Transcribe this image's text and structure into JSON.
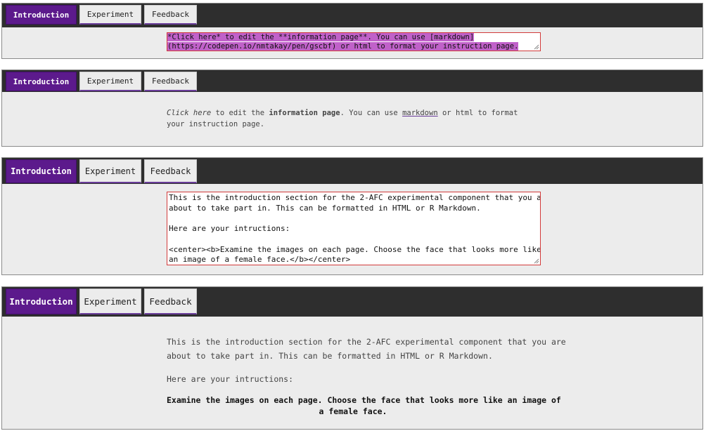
{
  "tabs": {
    "intro": "Introduction",
    "experiment": "Experiment",
    "feedback": "Feedback"
  },
  "colors": {
    "active_tab": "#5c1a8c",
    "tab_bar": "#2e2e2e",
    "panel": "#ececec",
    "highlight": "#c061c9",
    "editor_border": "#d23a3a"
  },
  "panel1": {
    "line1": "*Click here* to edit the **information page**. You can use [markdown]",
    "line2": "(https://codepen.io/nmtakay/pen/gscbf) or html to format your instruction page."
  },
  "panel2": {
    "click_here": "Click here",
    "to_edit": " to edit the ",
    "info_page": "information page",
    "you_can_use": ". You can use ",
    "markdown": "markdown",
    "or_html": " or html to format",
    "line2": "your instruction page."
  },
  "panel3": {
    "line1": "This is the introduction section for the 2-AFC experimental component that you are",
    "line2": "about to take part in. This can be formatted in HTML or R Markdown.",
    "line3": "Here are your intructions:",
    "line4": "<center><b>Examine the images on each page. Choose the face that looks more like",
    "line5": "an image of a female face.</b></center>"
  },
  "panel4": {
    "line1": "This is the introduction section for the 2-AFC experimental component that you are",
    "line2": "about to take part in. This can be formatted in HTML or R Markdown.",
    "line3": "Here are your intructions:",
    "center1": "Examine the images on each page. Choose the face that looks more like an image of",
    "center2": "a female face."
  }
}
